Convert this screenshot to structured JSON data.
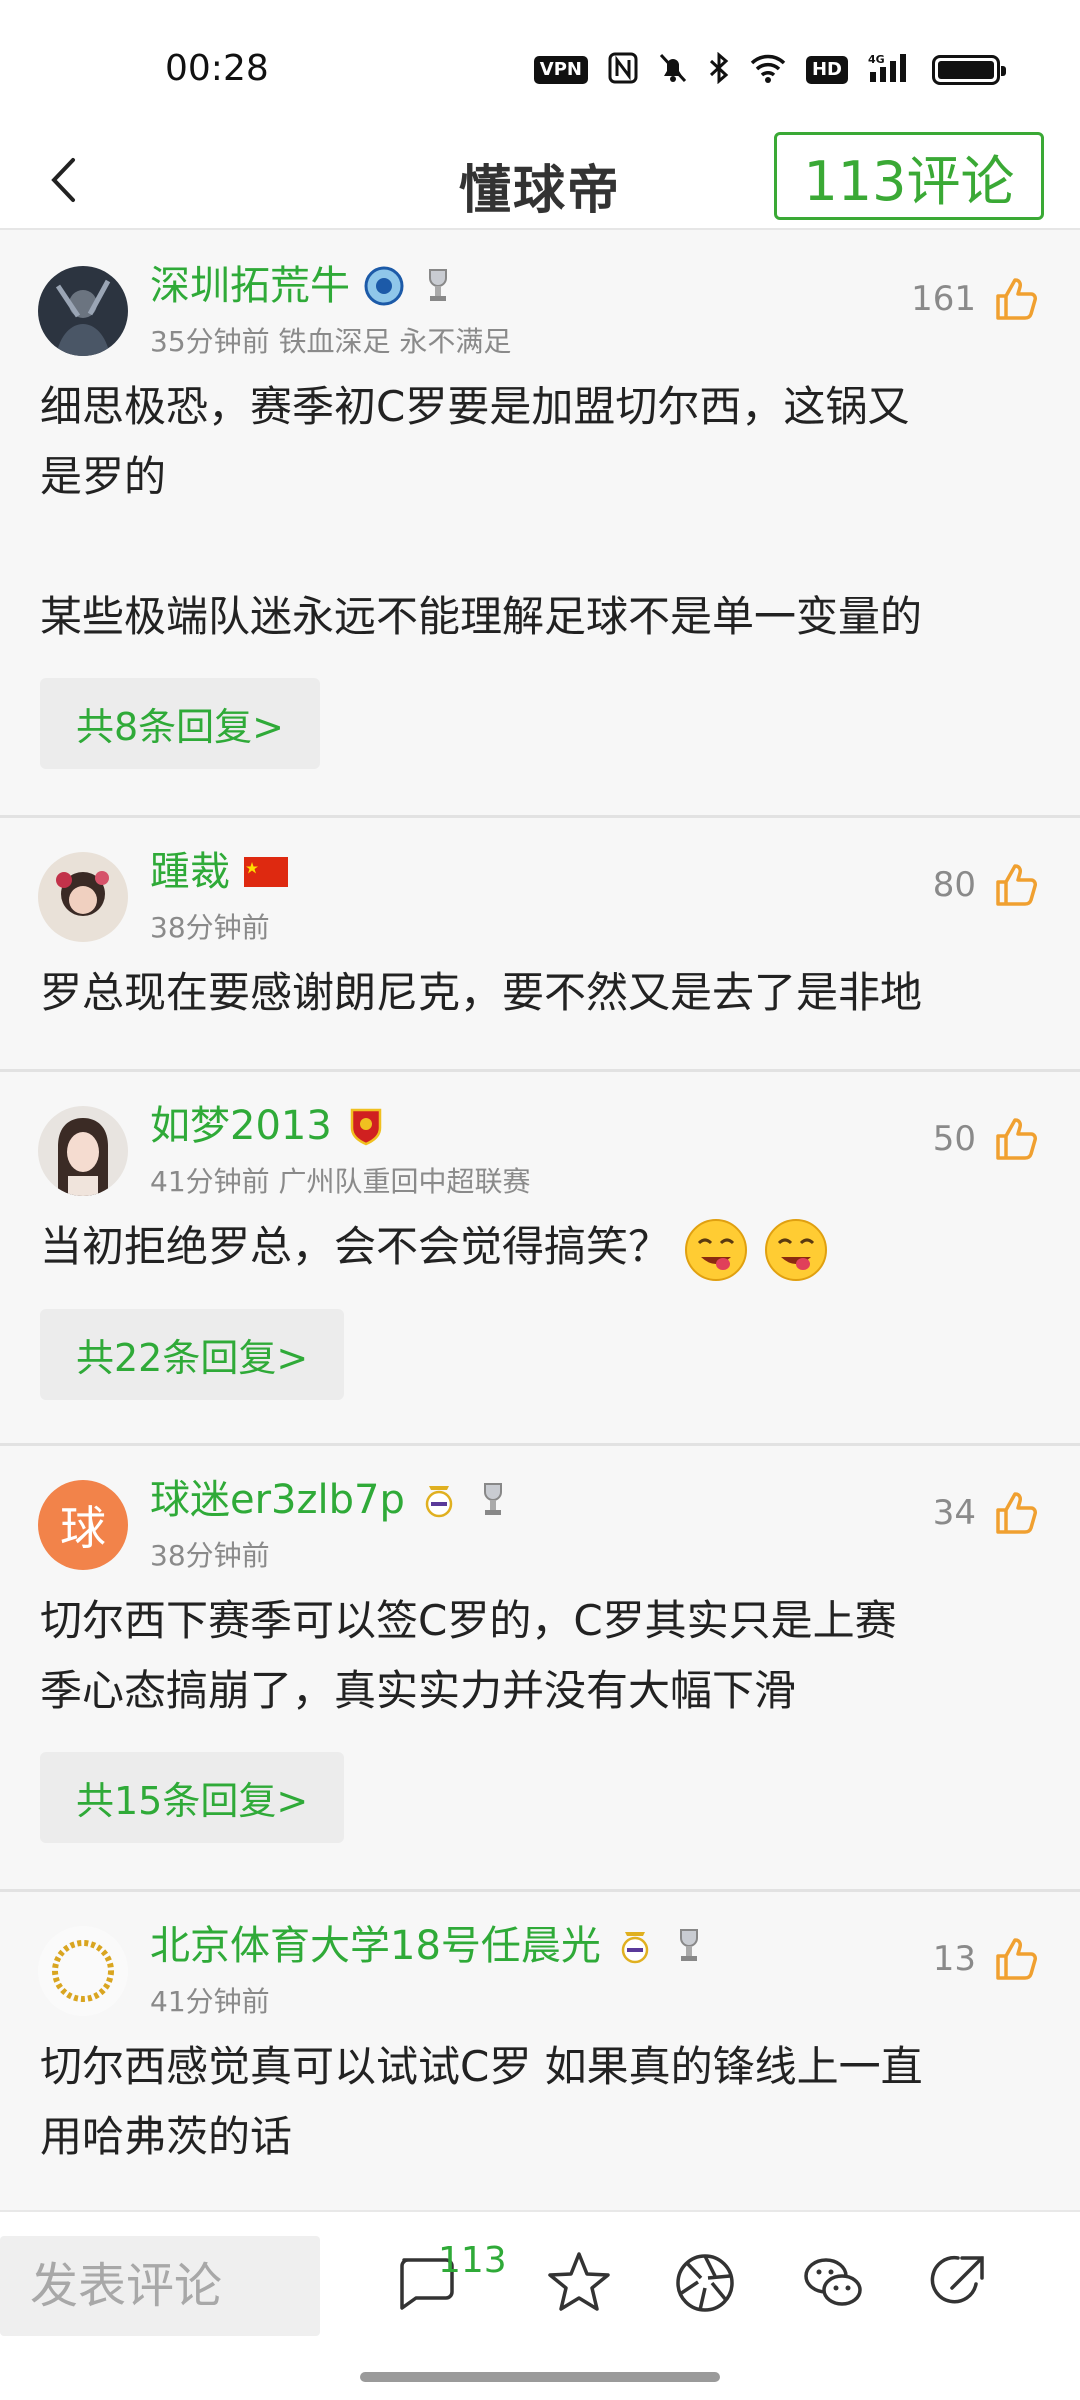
{
  "status_bar": {
    "time": "00:28",
    "vpn": "VPN",
    "hd": "HD",
    "network": "4G"
  },
  "header": {
    "title": "懂球帝",
    "comment_count_label": "113评论",
    "back_icon": "chevron-left-icon"
  },
  "comments": [
    {
      "username": "深圳拓荒牛",
      "meta": "35分钟前 铁血深足 永不满足",
      "likes": "161",
      "lines": [
        "细思极恐，赛季初C罗要是加盟切尔西，这锅又",
        "是罗的",
        "",
        "某些极端队迷永远不能理解足球不是单一变量的"
      ],
      "reply": "共8条回复>"
    },
    {
      "username": "踵裁",
      "meta": "38分钟前",
      "likes": "80",
      "lines": [
        "罗总现在要感谢朗尼克，要不然又是去了是非地"
      ],
      "reply": ""
    },
    {
      "username": "如梦2013",
      "meta": "41分钟前 广州队重回中超联赛",
      "likes": "50",
      "lines": [
        "当初拒绝罗总，会不会觉得搞笑？"
      ],
      "reply": "共22条回复>"
    },
    {
      "username": "球迷er3zlb7p",
      "avatar_text": "球",
      "meta": "38分钟前",
      "likes": "34",
      "lines": [
        "切尔西下赛季可以签C罗的，C罗其实只是上赛",
        "季心态搞崩了，真实实力并没有大幅下滑"
      ],
      "reply": "共15条回复>"
    },
    {
      "username": "北京体育大学18号任晨光",
      "meta": "41分钟前",
      "likes": "13",
      "lines": [
        "切尔西感觉真可以试试C罗 如果真的锋线上一直",
        "用哈弗茨的话"
      ],
      "reply": ""
    }
  ],
  "bottom_bar": {
    "input_placeholder": "发表评论",
    "comment_count": "113"
  },
  "colors": {
    "accent_green": "#2faa38",
    "like_orange": "#f0a030"
  }
}
